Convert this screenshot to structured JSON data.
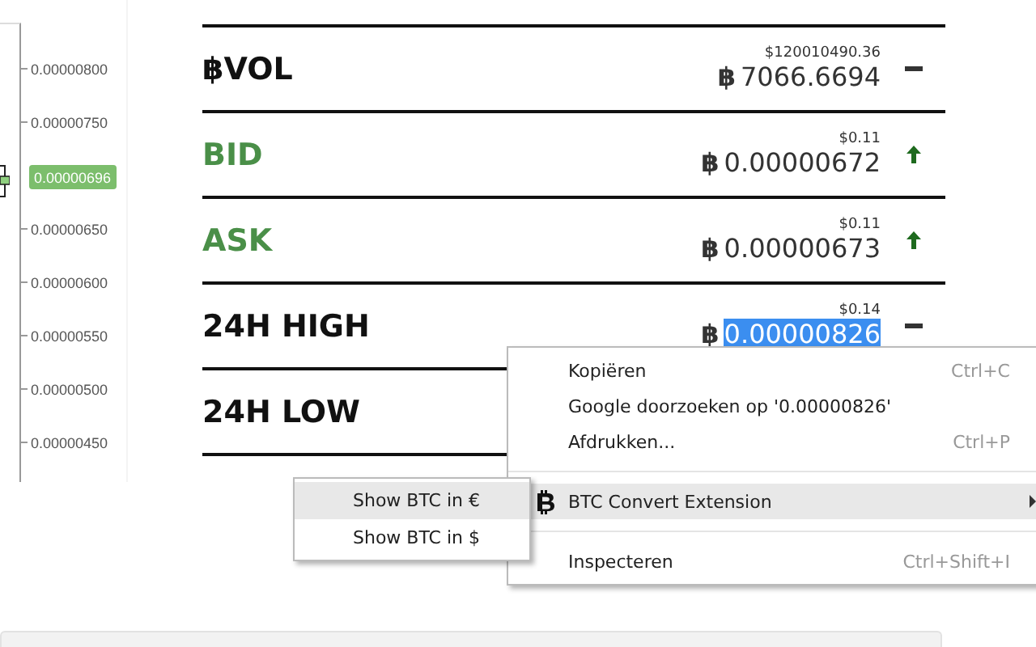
{
  "price_axis": {
    "labels": [
      "0.00000800",
      "0.00000750",
      "0.00000650",
      "0.00000600",
      "0.00000550",
      "0.00000500",
      "0.00000450"
    ],
    "current_price": "0.00000696"
  },
  "ticker": [
    {
      "label": "฿VOL",
      "color": "#111111",
      "usd": "$120010490.36",
      "symbol": "฿",
      "value": "7066.6694",
      "selected": false,
      "kind": "flat"
    },
    {
      "label": "BID",
      "color": "#4a8f48",
      "usd": "$0.11",
      "symbol": "฿",
      "value": "0.00000672",
      "selected": false,
      "kind": "up"
    },
    {
      "label": "ASK",
      "color": "#4a8f48",
      "usd": "$0.11",
      "symbol": "฿",
      "value": "0.00000673",
      "selected": false,
      "kind": "up"
    },
    {
      "label": "24H HIGH",
      "color": "#111111",
      "usd": "$0.14",
      "symbol": "฿",
      "value": "0.00000826",
      "selected": true,
      "kind": "flat"
    },
    {
      "label": "24H LOW",
      "color": "#111111"
    }
  ],
  "context_menu": {
    "items": [
      {
        "kind": "item",
        "label": "Kopiëren",
        "shortcut": "Ctrl+C",
        "selected": false
      },
      {
        "kind": "item",
        "label": "Google doorzoeken op '0.00000826'",
        "selected": false
      },
      {
        "kind": "item",
        "label": "Afdrukken...",
        "shortcut": "Ctrl+P",
        "selected": false
      },
      {
        "kind": "separator"
      },
      {
        "kind": "submenu",
        "label": "BTC Convert Extension",
        "selected": true
      },
      {
        "kind": "separator"
      },
      {
        "kind": "item",
        "label": "Inspecteren",
        "shortcut": "Ctrl+Shift+I",
        "selected": false
      }
    ]
  },
  "submenu": {
    "items": [
      {
        "label": "Show BTC in €",
        "selected": true
      },
      {
        "label": "Show BTC in $",
        "selected": false
      }
    ]
  }
}
